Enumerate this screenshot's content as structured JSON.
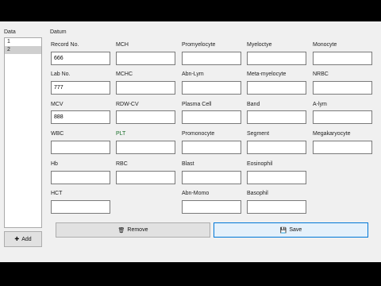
{
  "window": {
    "data_group_label": "Data",
    "datum_group_label": "Datum"
  },
  "data_list": {
    "items": [
      {
        "label": "1",
        "selected": false
      },
      {
        "label": "2",
        "selected": true
      }
    ]
  },
  "buttons": {
    "add": "Add",
    "remove": "Remove",
    "save": "Save"
  },
  "fields": {
    "record_no": {
      "label": "Record No.",
      "value": "666"
    },
    "mch": {
      "label": "MCH",
      "value": ""
    },
    "promyelocyte": {
      "label": "Promyelocyte",
      "value": ""
    },
    "myeloctye": {
      "label": "Myeloctye",
      "value": ""
    },
    "monocyte": {
      "label": "Monocyte",
      "value": ""
    },
    "lab_no": {
      "label": "Lab No.",
      "value": "777"
    },
    "mchc": {
      "label": "MCHC",
      "value": ""
    },
    "abn_lym": {
      "label": "Abn-Lym",
      "value": ""
    },
    "meta_myelocyte": {
      "label": "Meta-myelocyte",
      "value": ""
    },
    "nrbc": {
      "label": "NRBC",
      "value": ""
    },
    "mcv": {
      "label": "MCV",
      "value": "888"
    },
    "rdw_cv": {
      "label": "RDW-CV",
      "value": ""
    },
    "plasma_cell": {
      "label": "Plasma Cell",
      "value": ""
    },
    "band": {
      "label": "Band",
      "value": ""
    },
    "a_lym": {
      "label": "A-lym",
      "value": ""
    },
    "wbc": {
      "label": "WBC",
      "value": ""
    },
    "plt": {
      "label": "PLT",
      "value": ""
    },
    "promonocyte": {
      "label": "Promonocyte",
      "value": ""
    },
    "segment": {
      "label": "Segment",
      "value": ""
    },
    "megakaryocyte": {
      "label": "Megakaryocyte",
      "value": ""
    },
    "hb": {
      "label": "Hb",
      "value": ""
    },
    "rbc": {
      "label": "RBC",
      "value": ""
    },
    "blast": {
      "label": "Blast",
      "value": ""
    },
    "eosinophil": {
      "label": "Eosinophil",
      "value": ""
    },
    "hct": {
      "label": "HCT",
      "value": ""
    },
    "abn_momo": {
      "label": "Abn-Momo",
      "value": ""
    },
    "basophil": {
      "label": "Basophil",
      "value": ""
    }
  }
}
